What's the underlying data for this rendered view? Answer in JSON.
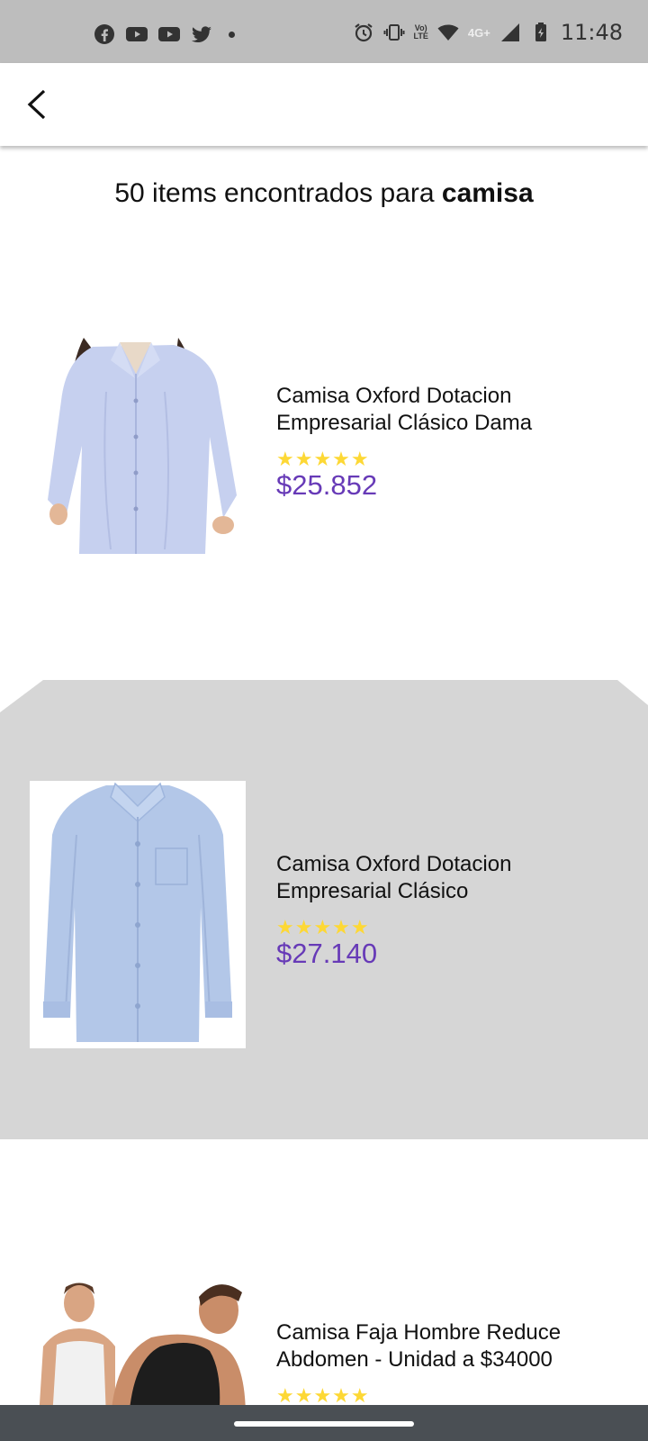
{
  "status_bar": {
    "time": "11:48",
    "network_small": "Vo)\nLTE",
    "network_label": "4G+",
    "left_icons": [
      "facebook-icon",
      "youtube-icon",
      "youtube-icon",
      "twitter-icon"
    ],
    "right_icons": [
      "alarm-icon",
      "vibrate-icon",
      "volte-icon",
      "wifi-icon",
      "signal-icon",
      "battery-icon"
    ]
  },
  "app_bar": {
    "back_icon": "chevron-left-icon"
  },
  "results": {
    "count_text": "50 items encontrados para ",
    "query": "camisa"
  },
  "products": [
    {
      "name": "Camisa Oxford Dotacion Empresarial Clásico Dama",
      "stars": "★★★★★",
      "rating": 5,
      "price": "$25.852"
    },
    {
      "name": "Camisa Oxford Dotacion Empresarial Clásico",
      "stars": "★★★★★",
      "rating": 5,
      "price": "$27.140"
    },
    {
      "name": "Camisa Faja Hombre Reduce Abdomen - Unidad a $34000",
      "stars": "★★★★★",
      "rating": 5
    }
  ],
  "colors": {
    "price": "#673ab7",
    "star": "#fdd835",
    "selected_row": "#d6d6d6",
    "status_bar": "#bdbdbd",
    "nav_bar": "#4a4f54"
  }
}
